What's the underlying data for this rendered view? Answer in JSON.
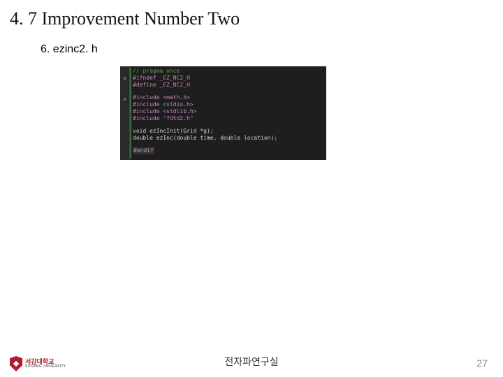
{
  "title": "4. 7 Improvement Number Two",
  "subitem": "6. ezinc2. h",
  "code": {
    "lines": [
      {
        "cls": "c-comment",
        "text": "// pragma once"
      },
      {
        "cls": "c-pre",
        "text": "#ifndef _EZ_NC2_H"
      },
      {
        "cls": "c-pre",
        "text": "#define _EZ_NC2_H"
      },
      {
        "cls": "blank",
        "text": ""
      },
      {
        "cls": "c-pre",
        "text": "#include <math.h>"
      },
      {
        "cls": "c-pre",
        "text": "#include <stdio.h>"
      },
      {
        "cls": "c-pre",
        "text": "#include <stdlib.h>"
      },
      {
        "cls": "c-pre",
        "text": "#include \"fdtd2.h\""
      },
      {
        "cls": "blank",
        "text": ""
      },
      {
        "cls": "c-ident",
        "text": "void ezIncInit(Grid *g);"
      },
      {
        "cls": "c-ident",
        "text": "double ezInc(double time, double location);"
      },
      {
        "cls": "blank",
        "text": ""
      },
      {
        "cls": "c-pre",
        "text": "#endif",
        "boxed": true
      }
    ],
    "fold_rows": [
      1,
      4
    ]
  },
  "footer": "전자파연구실",
  "page": "27",
  "logo": {
    "kr": "서강대학교",
    "en": "SOGANG UNIVERSITY"
  }
}
